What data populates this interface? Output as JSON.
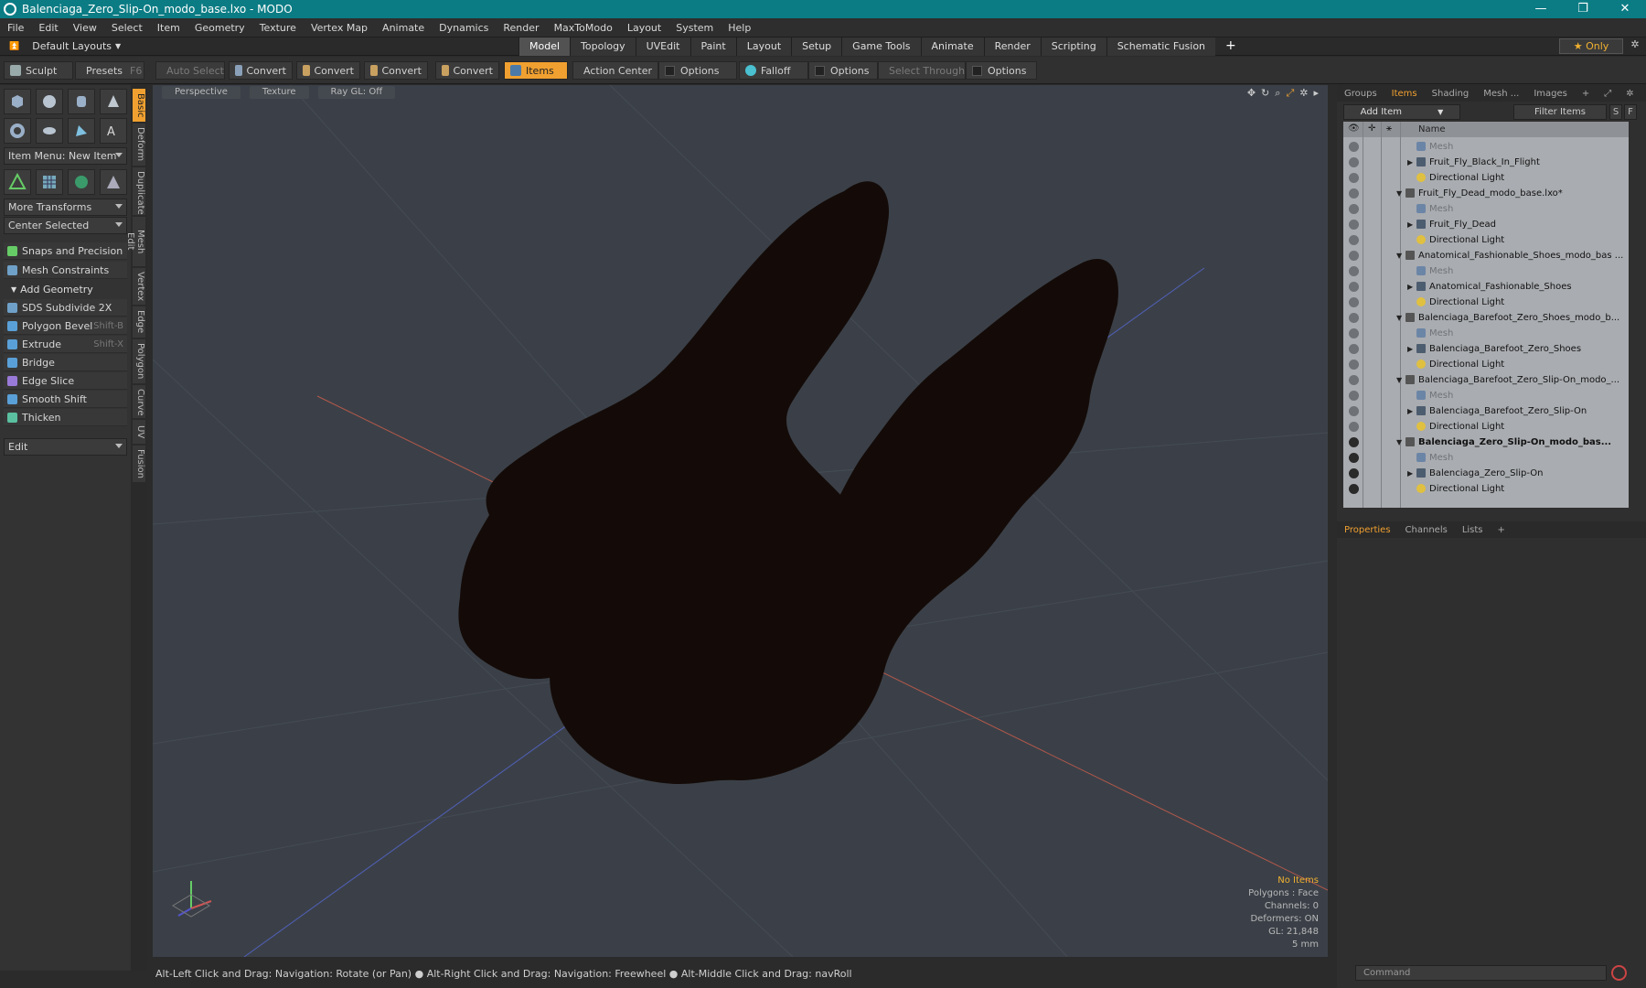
{
  "window": {
    "title": "Balenciaga_Zero_Slip-On_modo_base.lxo - MODO",
    "controls": [
      "—",
      "❐",
      "✕"
    ]
  },
  "menu": [
    "File",
    "Edit",
    "View",
    "Select",
    "Item",
    "Geometry",
    "Texture",
    "Vertex Map",
    "Animate",
    "Dynamics",
    "Render",
    "MaxToModo",
    "Layout",
    "System",
    "Help"
  ],
  "layoutbar": {
    "default_layouts": "Default Layouts",
    "tabs": [
      "Model",
      "Topology",
      "UVEdit",
      "Paint",
      "Layout",
      "Setup",
      "Game Tools",
      "Animate",
      "Render",
      "Scripting",
      "Schematic Fusion"
    ],
    "active_tab": "Model",
    "only": "★ Only"
  },
  "toolbar": {
    "sculpt": "Sculpt",
    "presets": "Presets",
    "presets_key": "F6",
    "auto_select": "Auto Select",
    "convert1": "Convert",
    "convert2": "Convert",
    "convert3": "Convert",
    "convert4": "Convert",
    "items": "Items",
    "action_center": "Action Center",
    "options1": "Options",
    "falloff": "Falloff",
    "options2": "Options",
    "select_through": "Select Through",
    "options3": "Options"
  },
  "leftpanel": {
    "item_menu": "Item Menu: New Item",
    "more_transforms": "More Transforms",
    "center_selected": "Center Selected",
    "snaps": "Snaps and Precision",
    "mesh_constraints": "Mesh Constraints",
    "add_geometry": "Add Geometry",
    "tools": [
      {
        "label": "SDS Subdivide 2X",
        "shortcut": ""
      },
      {
        "label": "Polygon Bevel",
        "shortcut": "Shift-B"
      },
      {
        "label": "Extrude",
        "shortcut": "Shift-X"
      },
      {
        "label": "Bridge",
        "shortcut": ""
      },
      {
        "label": "Edge Slice",
        "shortcut": ""
      },
      {
        "label": "Smooth Shift",
        "shortcut": ""
      },
      {
        "label": "Thicken",
        "shortcut": ""
      }
    ],
    "edit": "Edit"
  },
  "vtabs": [
    "Basic",
    "Deform",
    "Duplicate",
    "Mesh Edit",
    "Vertex",
    "Edge",
    "Polygon",
    "Curve",
    "UV",
    "Fusion"
  ],
  "viewport": {
    "view": "Perspective",
    "shading": "Texture",
    "raygl": "Ray GL: Off",
    "icons": [
      "move-icon",
      "rotate-icon",
      "zoom-icon",
      "fit-icon",
      "gear-icon"
    ],
    "stats": {
      "no_items": "No Items",
      "polygons": "Polygons : Face",
      "channels": "Channels: 0",
      "deformers": "Deformers: ON",
      "gl": "GL: 21,848",
      "scale": "5 mm"
    }
  },
  "statusbar": "Alt-Left Click and Drag: Navigation: Rotate (or Pan) ● Alt-Right Click and Drag: Navigation: Freewheel ● Alt-Middle Click and Drag: navRoll",
  "rightpanel": {
    "tabs": [
      "Groups",
      "Items",
      "Shading",
      "Mesh ...",
      "Images"
    ],
    "active_tab": "Items",
    "add_item": "Add Item",
    "filter_items": "Filter Items",
    "s_btn": "S",
    "f_btn": "F",
    "col_name": "Name",
    "items": [
      {
        "label": "Mesh",
        "type": "mesh-icon",
        "dim": true,
        "bold": false,
        "indent": 2,
        "tri": "",
        "eye": false
      },
      {
        "label": "Fruit_Fly_Black_In_Flight",
        "type": "group-icon",
        "dim": false,
        "bold": false,
        "indent": 2,
        "tri": "▶",
        "eye": false
      },
      {
        "label": "Directional Light",
        "type": "light-icon",
        "dim": false,
        "bold": false,
        "indent": 2,
        "tri": "",
        "eye": false
      },
      {
        "label": "Fruit_Fly_Dead_modo_base.lxo*",
        "type": "scene-icon",
        "dim": false,
        "bold": false,
        "indent": 1,
        "tri": "▼",
        "eye": false
      },
      {
        "label": "Mesh",
        "type": "mesh-icon",
        "dim": true,
        "bold": false,
        "indent": 2,
        "tri": "",
        "eye": false
      },
      {
        "label": "Fruit_Fly_Dead",
        "type": "group-icon",
        "dim": false,
        "bold": false,
        "indent": 2,
        "tri": "▶",
        "eye": false
      },
      {
        "label": "Directional Light",
        "type": "light-icon",
        "dim": false,
        "bold": false,
        "indent": 2,
        "tri": "",
        "eye": false
      },
      {
        "label": "Anatomical_Fashionable_Shoes_modo_bas ...",
        "type": "scene-icon",
        "dim": false,
        "bold": false,
        "indent": 1,
        "tri": "▼",
        "eye": false
      },
      {
        "label": "Mesh",
        "type": "mesh-icon",
        "dim": true,
        "bold": false,
        "indent": 2,
        "tri": "",
        "eye": false
      },
      {
        "label": "Anatomical_Fashionable_Shoes",
        "type": "group-icon",
        "dim": false,
        "bold": false,
        "indent": 2,
        "tri": "▶",
        "eye": false
      },
      {
        "label": "Directional Light",
        "type": "light-icon",
        "dim": false,
        "bold": false,
        "indent": 2,
        "tri": "",
        "eye": false
      },
      {
        "label": "Balenciaga_Barefoot_Zero_Shoes_modo_b...",
        "type": "scene-icon",
        "dim": false,
        "bold": false,
        "indent": 1,
        "tri": "▼",
        "eye": false
      },
      {
        "label": "Mesh",
        "type": "mesh-icon",
        "dim": true,
        "bold": false,
        "indent": 2,
        "tri": "",
        "eye": false
      },
      {
        "label": "Balenciaga_Barefoot_Zero_Shoes",
        "type": "group-icon",
        "dim": false,
        "bold": false,
        "indent": 2,
        "tri": "▶",
        "eye": false
      },
      {
        "label": "Directional Light",
        "type": "light-icon",
        "dim": false,
        "bold": false,
        "indent": 2,
        "tri": "",
        "eye": false
      },
      {
        "label": "Balenciaga_Barefoot_Zero_Slip-On_modo_...",
        "type": "scene-icon",
        "dim": false,
        "bold": false,
        "indent": 1,
        "tri": "▼",
        "eye": false
      },
      {
        "label": "Mesh",
        "type": "mesh-icon",
        "dim": true,
        "bold": false,
        "indent": 2,
        "tri": "",
        "eye": false
      },
      {
        "label": "Balenciaga_Barefoot_Zero_Slip-On",
        "type": "group-icon",
        "dim": false,
        "bold": false,
        "indent": 2,
        "tri": "▶",
        "eye": false
      },
      {
        "label": "Directional Light",
        "type": "light-icon",
        "dim": false,
        "bold": false,
        "indent": 2,
        "tri": "",
        "eye": false
      },
      {
        "label": "Balenciaga_Zero_Slip-On_modo_bas...",
        "type": "scene-icon",
        "dim": false,
        "bold": true,
        "indent": 1,
        "tri": "▼",
        "eye": true
      },
      {
        "label": "Mesh",
        "type": "mesh-icon",
        "dim": true,
        "bold": false,
        "indent": 2,
        "tri": "",
        "eye": true
      },
      {
        "label": "Balenciaga_Zero_Slip-On",
        "type": "group-icon",
        "dim": false,
        "bold": false,
        "indent": 2,
        "tri": "▶",
        "eye": true
      },
      {
        "label": "Directional Light",
        "type": "light-icon",
        "dim": false,
        "bold": false,
        "indent": 2,
        "tri": "",
        "eye": true
      }
    ],
    "props_tabs": [
      "Properties",
      "Channels",
      "Lists"
    ],
    "props_active": "Properties",
    "command_placeholder": "Command"
  },
  "colors": {
    "accent": "#f0a030",
    "titlebar": "#0b7c84",
    "shoe": "#140b08",
    "viewport_bg": "#3b4048"
  }
}
